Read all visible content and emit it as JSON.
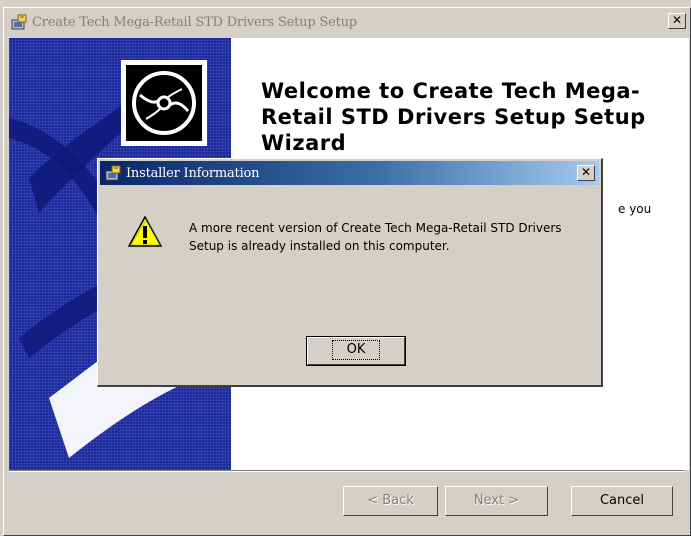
{
  "main_window": {
    "title": "Create Tech Mega-Retail STD Drivers Setup Setup",
    "close_glyph": "✕",
    "welcome_heading": "Welcome to Create Tech Mega-Retail STD Drivers Setup Setup Wizard",
    "body_text_fragment": "e you",
    "buttons": {
      "back_label": "< Back",
      "next_label": "Next >",
      "cancel_label": "Cancel"
    },
    "panel_color": "#1c2aa0"
  },
  "dialog": {
    "title": "Installer Information",
    "close_glyph": "✕",
    "icon": "warning-icon",
    "message": "A more recent version of Create Tech Mega-Retail STD Drivers Setup is already installed on this computer.",
    "ok_label": "OK",
    "titlebar_color": "#0a246a"
  }
}
